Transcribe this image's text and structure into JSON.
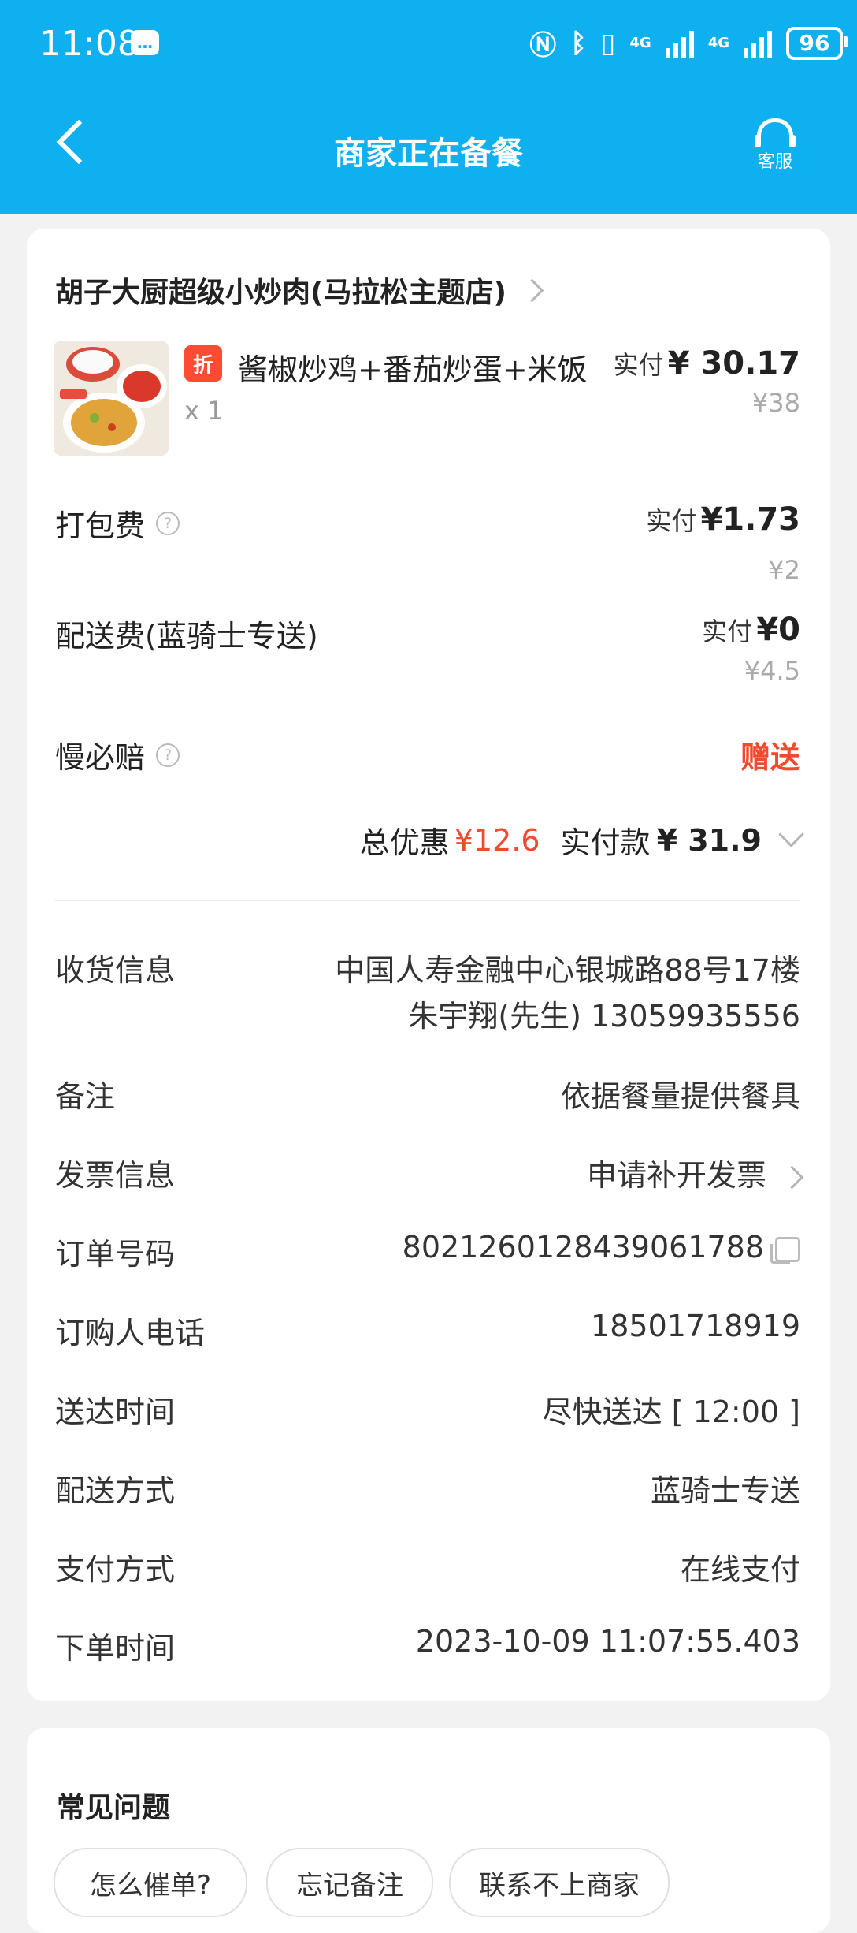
{
  "status_bar": {
    "time": "11:08",
    "msg_icon": "message-icon",
    "network_1": "4G",
    "network_2": "4G",
    "battery": "96"
  },
  "header": {
    "title": "商家正在备餐",
    "service_label": "客服",
    "bg_color": "#0fb0f0"
  },
  "order": {
    "shop_name": "胡子大厨超级小炒肉(马拉松主题店)",
    "item": {
      "discount_badge": "折",
      "name": "酱椒炒鸡+番茄炒蛋+米饭",
      "qty": "x 1",
      "paid_label": "实付",
      "paid_value": "¥ 30.17",
      "original_price": "¥38"
    },
    "fees": [
      {
        "label": "打包费",
        "paid_label": "实付",
        "paid_value": "¥1.73",
        "original": "¥2"
      },
      {
        "label": "配送费(蓝骑士专送)",
        "paid_label": "实付",
        "paid_value": "¥0",
        "original": "¥4.5"
      }
    ],
    "slow_compensation": {
      "label": "慢必赔",
      "value": "赠送"
    },
    "summary": {
      "discount_label": "总优惠",
      "discount_value": "¥12.6",
      "paid_label": "实付款",
      "paid_value": "¥ 31.9"
    }
  },
  "info": {
    "receiver": {
      "label": "收货信息",
      "address": "中国人寿金融中心银城路88号17楼",
      "contact": "朱宇翔(先生) 13059935556"
    },
    "note": {
      "label": "备注",
      "value": "依据餐量提供餐具"
    },
    "invoice": {
      "label": "发票信息",
      "value": "申请补开发票"
    },
    "order_no": {
      "label": "订单号码",
      "value": "8021260128439061788"
    },
    "buyer_phone": {
      "label": "订购人电话",
      "value": "18501718919"
    },
    "delivery_time": {
      "label": "送达时间",
      "value": "尽快送达 [ 12:00 ]"
    },
    "delivery_method": {
      "label": "配送方式",
      "value": "蓝骑士专送"
    },
    "payment_method": {
      "label": "支付方式",
      "value": "在线支付"
    },
    "order_time": {
      "label": "下单时间",
      "value": "2023-10-09 11:07:55.403"
    }
  },
  "faq": {
    "title": "常见问题",
    "chips": [
      "怎么催单?",
      "忘记备注",
      "联系不上商家"
    ]
  }
}
